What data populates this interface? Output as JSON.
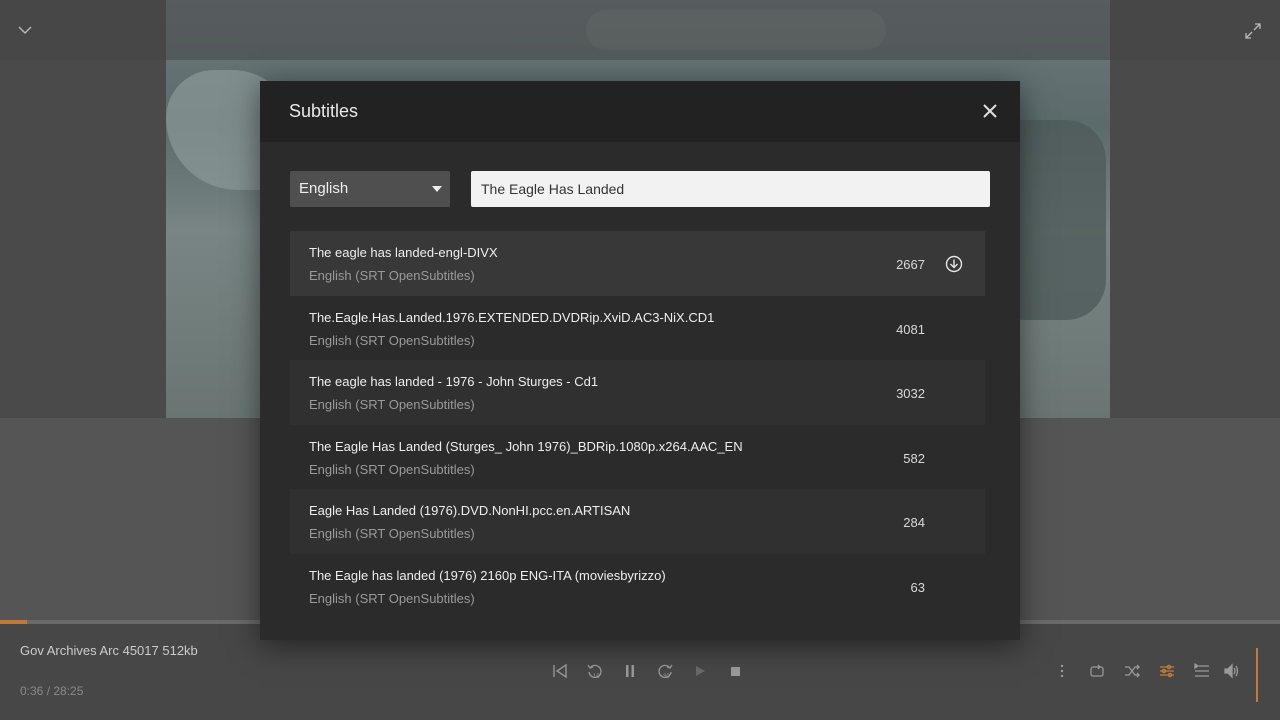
{
  "dialog": {
    "title": "Subtitles",
    "language": {
      "selected": "English"
    },
    "search": {
      "value": "The Eagle Has Landed",
      "placeholder": ""
    },
    "results": [
      {
        "name": "The eagle has landed-engl-DIVX",
        "source": "English (SRT OpenSubtitles)",
        "count": "2667",
        "download_visible": true
      },
      {
        "name": "The.Eagle.Has.Landed.1976.EXTENDED.DVDRip.XviD.AC3-NiX.CD1",
        "source": "English (SRT OpenSubtitles)",
        "count": "4081"
      },
      {
        "name": "The eagle has landed - 1976 - John Sturges - Cd1",
        "source": "English (SRT OpenSubtitles)",
        "count": "3032"
      },
      {
        "name": "The Eagle Has Landed (Sturges_ John 1976)_BDRip.1080p.x264.AAC_EN",
        "source": "English (SRT OpenSubtitles)",
        "count": "582"
      },
      {
        "name": "Eagle Has Landed (1976).DVD.NonHI.pcc.en.ARTISAN",
        "source": "English (SRT OpenSubtitles)",
        "count": "284"
      },
      {
        "name": "The Eagle has landed (1976) 2160p ENG-ITA (moviesbyrizzo)",
        "source": "English (SRT OpenSubtitles)",
        "count": "63"
      }
    ]
  },
  "player": {
    "media_title": "Gov Archives Arc 45017 512kb",
    "time": "0:36 / 28:25",
    "progress_fraction": 0.021,
    "accent_color": "#c07a3a"
  },
  "icons": {
    "top_left": "chevron-down-icon",
    "top_right": "expand-icon",
    "close": "close-icon",
    "download": "download-icon"
  }
}
